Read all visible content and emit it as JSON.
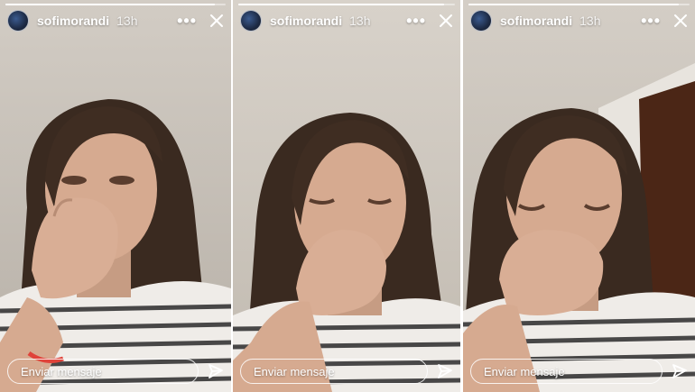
{
  "stories": [
    {
      "username": "sofimorandi",
      "time": "13h",
      "message_placeholder": "Enviar mensaje",
      "progress": 0.95
    },
    {
      "username": "sofimorandi",
      "time": "13h",
      "message_placeholder": "Enviar mensaje",
      "progress": 0.95
    },
    {
      "username": "sofimorandi",
      "time": "13h",
      "message_placeholder": "Enviar mensaje",
      "progress": 0.95
    }
  ],
  "icons": {
    "more": "more-options-icon",
    "close": "close-icon",
    "send": "send-icon"
  },
  "colors": {
    "overlay_text": "#ffffff",
    "wall": "#cfc9c2"
  }
}
